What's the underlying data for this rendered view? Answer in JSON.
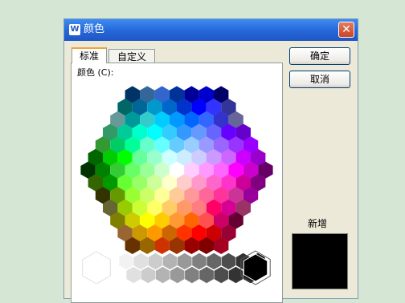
{
  "dialog": {
    "title": "颜色",
    "app_icon": "W",
    "close_label": "✕"
  },
  "tabs": [
    {
      "label": "标准",
      "active": true
    },
    {
      "label": "自定义",
      "active": false
    }
  ],
  "color_field_label": "颜色 (C):",
  "buttons": {
    "ok": "确定",
    "cancel": "取消"
  },
  "new_color": {
    "label": "新增",
    "value": "#000000"
  },
  "grays": [
    "#ffffff",
    "#f2f2f2",
    "#e0e0e0",
    "#cccccc",
    "#b3b3b3",
    "#999999",
    "#808080",
    "#666666",
    "#4d4d4d",
    "#333333",
    "#1a1a1a",
    "#000000"
  ],
  "selected_color": "#000000",
  "hex_palette": [
    [
      "#003366",
      "#336699",
      "#3366cc",
      "#003399",
      "#000099",
      "#0000cc",
      "#000066"
    ],
    [
      "#006666",
      "#006699",
      "#0099cc",
      "#0066cc",
      "#0033cc",
      "#0000ff",
      "#3333ff",
      "#333399"
    ],
    [
      "#669999",
      "#009999",
      "#33cccc",
      "#00ccff",
      "#0099ff",
      "#0066ff",
      "#3366ff",
      "#3333cc",
      "#666699"
    ],
    [
      "#339966",
      "#00cc99",
      "#00ffcc",
      "#00ffff",
      "#33ccff",
      "#3399ff",
      "#6699ff",
      "#6666ff",
      "#6600ff",
      "#6600cc"
    ],
    [
      "#339933",
      "#00cc66",
      "#00ff99",
      "#66ffcc",
      "#66ffff",
      "#66ccff",
      "#99ccff",
      "#9999ff",
      "#9966ff",
      "#9933ff",
      "#9900ff"
    ],
    [
      "#006600",
      "#00cc00",
      "#00ff00",
      "#66ff99",
      "#99ffcc",
      "#ccffff",
      "#ccecff",
      "#ccccff",
      "#cc99ff",
      "#cc66ff",
      "#cc00ff",
      "#9900cc"
    ],
    [
      "#003300",
      "#008000",
      "#33cc33",
      "#66ff66",
      "#99ff99",
      "#ccffcc",
      "#ffffff",
      "#ffccff",
      "#ff99ff",
      "#ff66ff",
      "#ff00ff",
      "#cc00cc",
      "#660066"
    ],
    [
      "#336600",
      "#009900",
      "#66ff33",
      "#99ff66",
      "#ccff99",
      "#ffffcc",
      "#ffcccc",
      "#ff99cc",
      "#ff66cc",
      "#ff33cc",
      "#cc0099",
      "#800080"
    ],
    [
      "#333300",
      "#669900",
      "#99ff33",
      "#ccff66",
      "#ffff99",
      "#ffcc99",
      "#ff9999",
      "#ff6699",
      "#ff3399",
      "#cc3399",
      "#990099"
    ],
    [
      "#666633",
      "#99cc00",
      "#ccff33",
      "#ffff66",
      "#ffcc66",
      "#ff9966",
      "#ff7c80",
      "#ff0066",
      "#d60093",
      "#993366"
    ],
    [
      "#808000",
      "#cccc00",
      "#ffff00",
      "#ffcc00",
      "#ff9933",
      "#ff6600",
      "#ff5050",
      "#cc0066",
      "#660033"
    ],
    [
      "#996633",
      "#cc9900",
      "#ff9900",
      "#cc6600",
      "#ff3300",
      "#ff0000",
      "#cc0000",
      "#990033"
    ],
    [
      "#663300",
      "#996600",
      "#cc3300",
      "#993300",
      "#990000",
      "#800000",
      "#a50021"
    ]
  ]
}
